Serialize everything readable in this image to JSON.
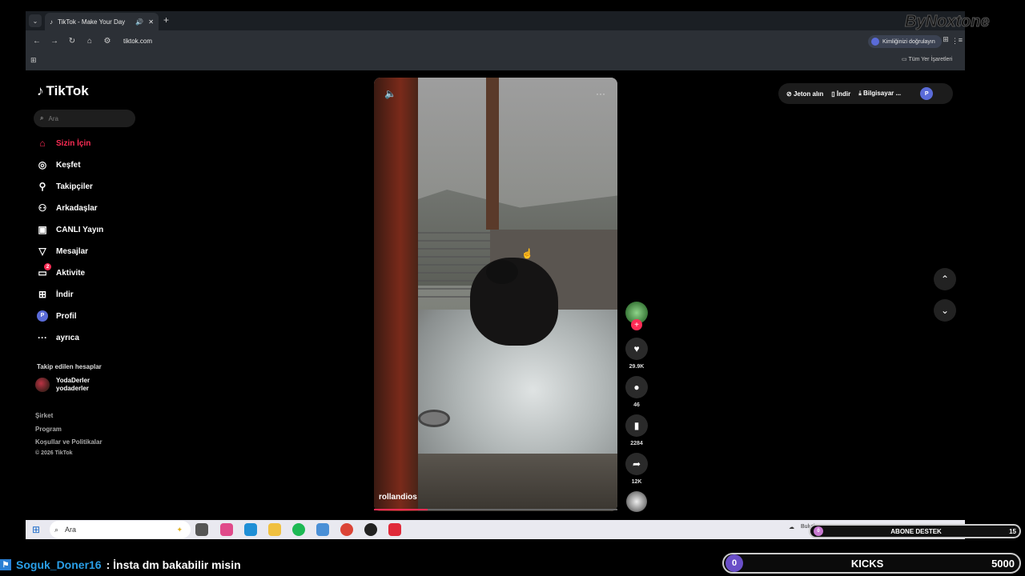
{
  "browser": {
    "tab_title": "TikTok - Make Your Day",
    "url": "tiktok.com",
    "verify_label": "Kimliğinizi doğrulayın",
    "verify_initial": "P",
    "all_bookmarks": "Tüm Yer İşaretleri"
  },
  "watermark": "ByNoxtone",
  "tiktok": {
    "logo": "TikTok",
    "search_placeholder": "Ara",
    "nav": [
      {
        "label": "Sizin İçin",
        "icon": "home-icon"
      },
      {
        "label": "Keşfet",
        "icon": "compass-icon"
      },
      {
        "label": "Takipçiler",
        "icon": "user-plus-icon"
      },
      {
        "label": "Arkadaşlar",
        "icon": "friends-icon"
      },
      {
        "label": "CANLI Yayın",
        "icon": "live-icon"
      },
      {
        "label": "Mesajlar",
        "icon": "message-icon"
      },
      {
        "label": "Aktivite",
        "icon": "activity-icon",
        "badge": "2"
      },
      {
        "label": "İndir",
        "icon": "download-icon"
      },
      {
        "label": "Profil",
        "icon": "profile-icon",
        "initial": "P"
      },
      {
        "label": "ayrıca",
        "icon": "more-icon"
      }
    ],
    "following_header": "Takip edilen hesaplar",
    "following_user": {
      "name": "YodaDerler",
      "handle": "yodaderler"
    },
    "footer": [
      "Şirket",
      "Program",
      "Koşullar ve Politikalar",
      "© 2026 TikTok"
    ],
    "video": {
      "username": "rollandios",
      "progress": 0.22
    },
    "actions": {
      "likes": "29.9K",
      "comments": "46",
      "saves": "2284",
      "shares": "12K"
    },
    "top_right": {
      "coins": "Jeton alın",
      "download": "İndir",
      "desktop": "Bilgisayar ...",
      "profile_initial": "P"
    }
  },
  "taskbar": {
    "search": "Ara",
    "weather": "Bulutlu"
  },
  "overlay": {
    "chat_user": "Soguk_Doner16",
    "chat_message": ": İnsta dm bakabilir misin",
    "abone_count": "0",
    "abone_label": "ABONE DESTEK",
    "abone_target": "15",
    "kicks_count": "0",
    "kicks_label": "KICKS",
    "kicks_target": "5000"
  }
}
